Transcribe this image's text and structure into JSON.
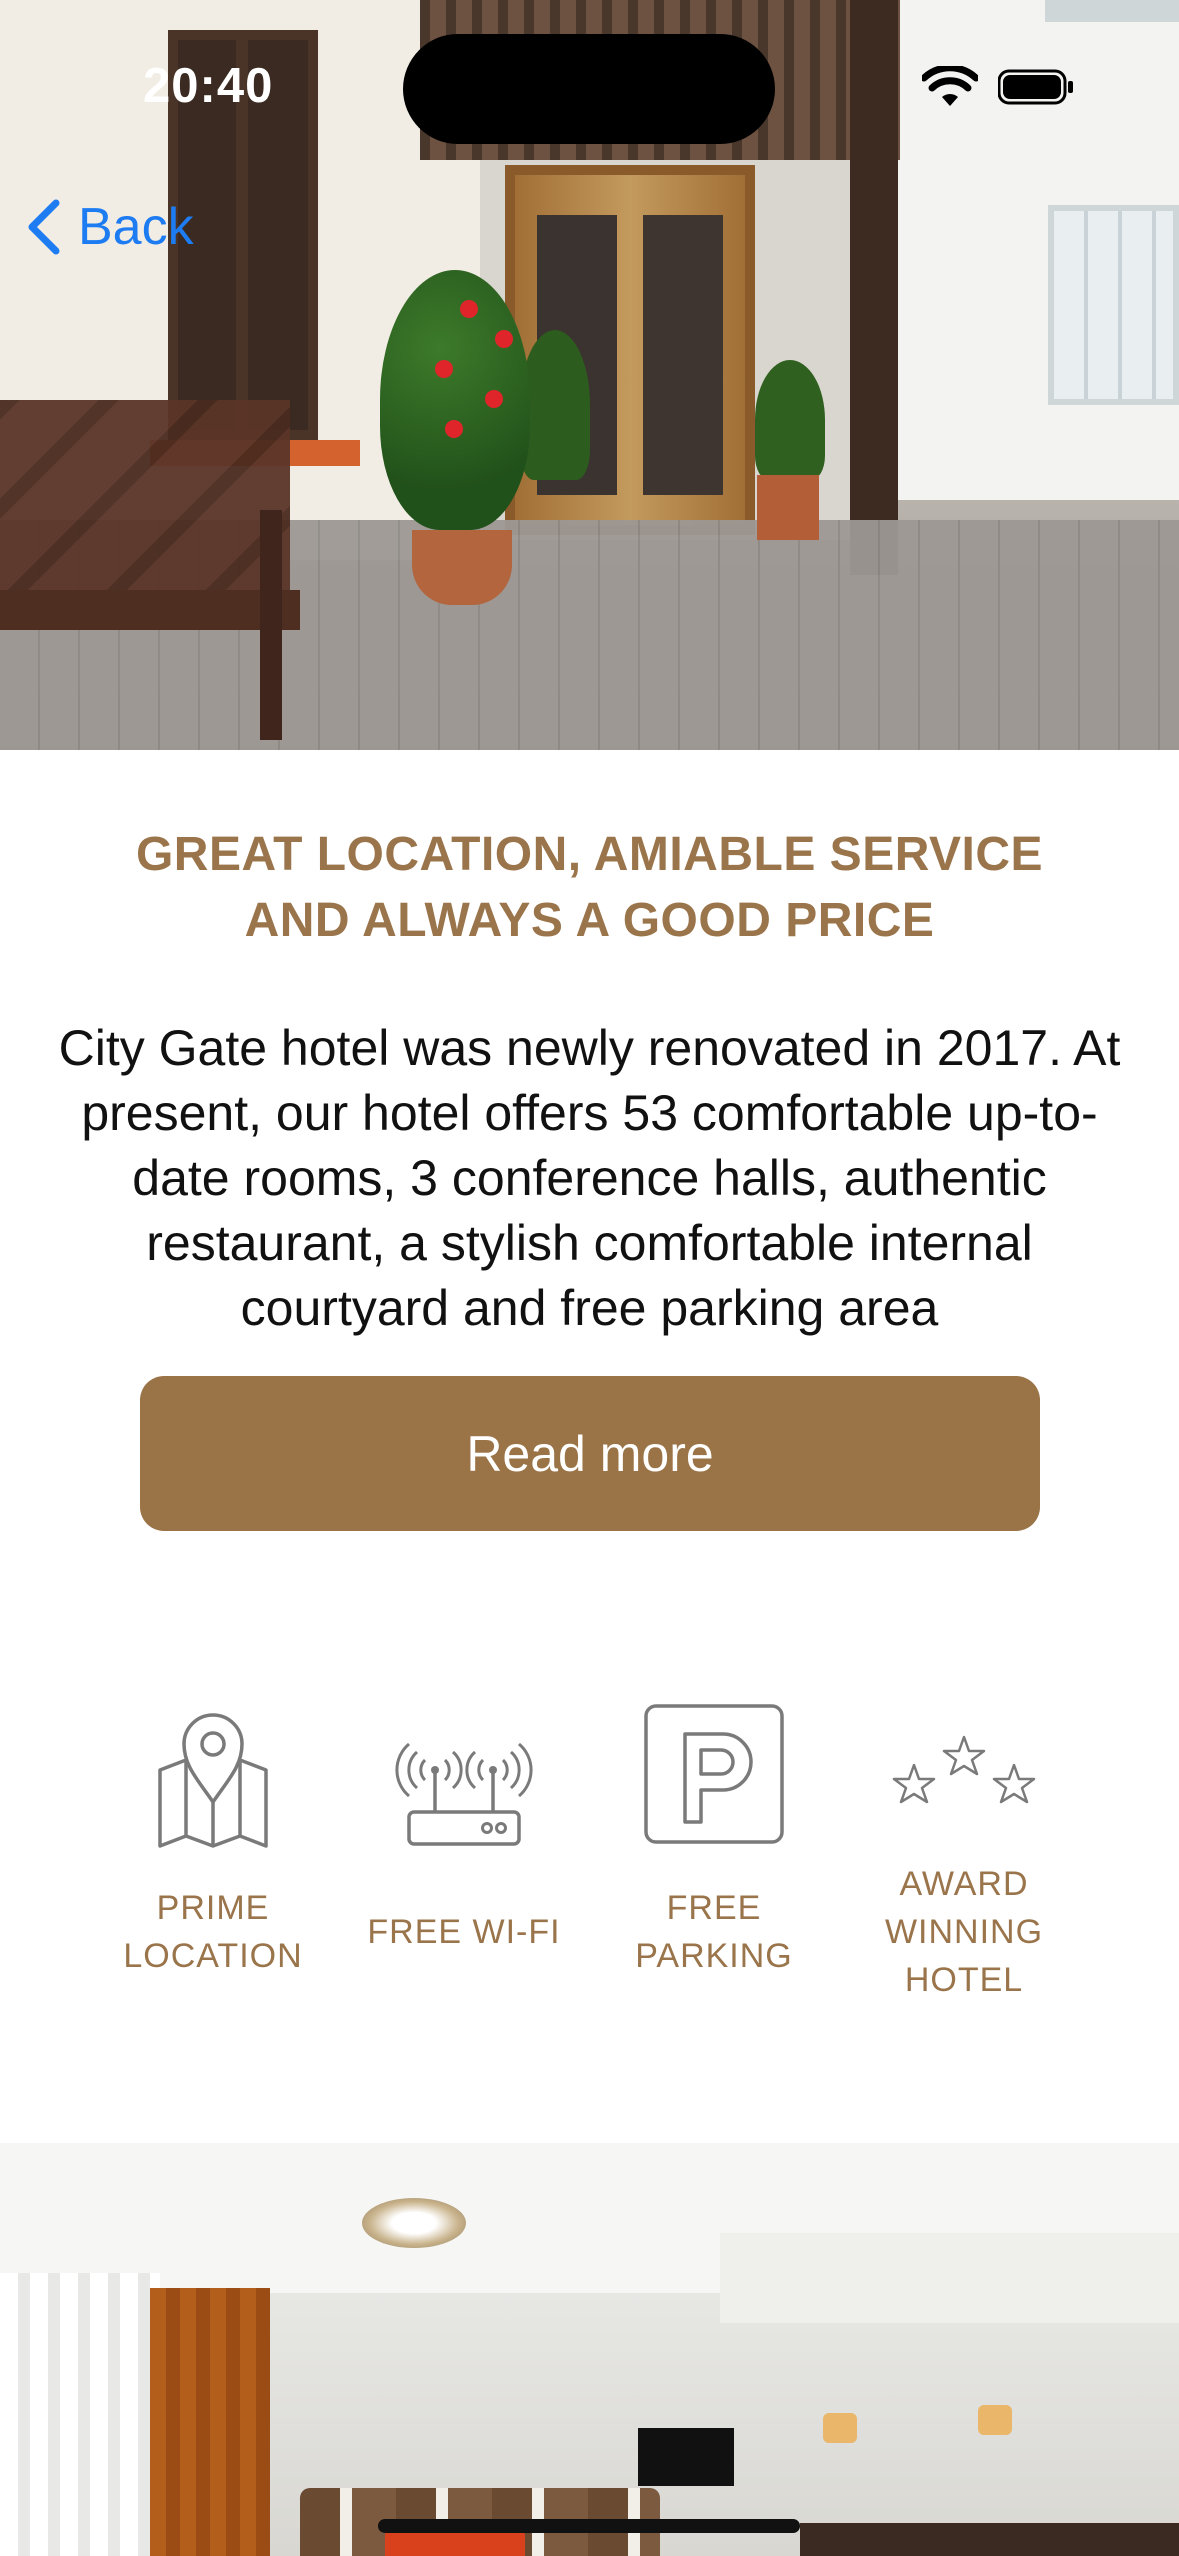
{
  "status_bar": {
    "time": "20:40"
  },
  "nav": {
    "back_label": "Back"
  },
  "main": {
    "headline_lines": [
      "GREAT LOCATION, AMIABLE SERVICE",
      "AND ALWAYS A GOOD PRICE"
    ],
    "description_lines": [
      "City Gate hotel was newly renovated in 2017. At",
      "present, our hotel offers 53 comfortable up-to-",
      "date rooms, 3 conference halls, authentic",
      "restaurant, a stylish comfortable internal",
      "courtyard and free parking area"
    ],
    "read_more_label": "Read more"
  },
  "features": [
    {
      "icon": "map-pin-icon",
      "label_lines": [
        "PRIME",
        "LOCATION"
      ]
    },
    {
      "icon": "router-icon",
      "label_lines": [
        "FREE WI-FI"
      ]
    },
    {
      "icon": "parking-icon",
      "label_lines": [
        "FREE",
        "PARKING"
      ]
    },
    {
      "icon": "stars-icon",
      "label_lines": [
        "AWARD",
        "WINNING",
        "HOTEL"
      ]
    }
  ],
  "colors": {
    "accent_brown": "#9a7347",
    "headline_brown": "#9a744a",
    "link_blue": "#1d7cf2"
  }
}
